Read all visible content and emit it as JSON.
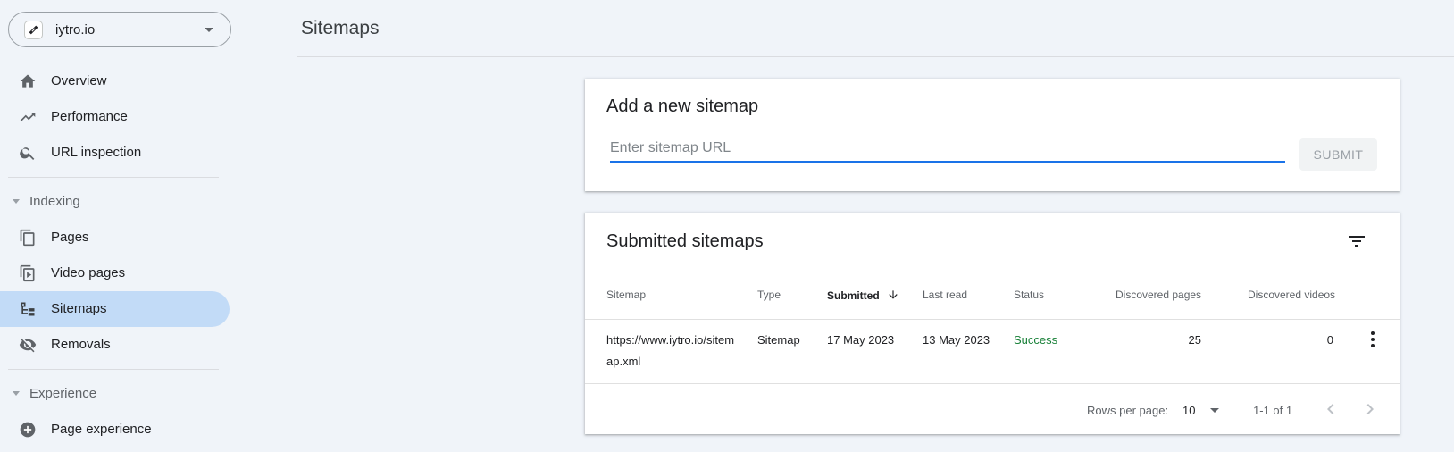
{
  "property": {
    "name": "iytro.io",
    "icon": "link-icon"
  },
  "nav": {
    "overview": {
      "label": "Overview",
      "icon": "home-icon"
    },
    "performance": {
      "label": "Performance",
      "icon": "trending-up-icon"
    },
    "url_inspection": {
      "label": "URL inspection",
      "icon": "search-icon"
    },
    "indexing_section": "Indexing",
    "pages": {
      "label": "Pages",
      "icon": "pages-icon"
    },
    "video_pages": {
      "label": "Video pages",
      "icon": "video-pages-icon"
    },
    "sitemaps": {
      "label": "Sitemaps",
      "icon": "sitemap-icon"
    },
    "removals": {
      "label": "Removals",
      "icon": "visibility-off-icon"
    },
    "experience_section": "Experience",
    "page_experience": {
      "label": "Page experience",
      "icon": "add-circle-icon"
    }
  },
  "header": {
    "title": "Sitemaps"
  },
  "add_card": {
    "title": "Add a new sitemap",
    "input_placeholder": "Enter sitemap URL",
    "input_value": "",
    "submit_label": "SUBMIT"
  },
  "submitted_card": {
    "title": "Submitted sitemaps",
    "columns": {
      "sitemap": "Sitemap",
      "type": "Type",
      "submitted": "Submitted",
      "last_read": "Last read",
      "status": "Status",
      "discovered_pages": "Discovered pages",
      "discovered_videos": "Discovered videos"
    },
    "rows": [
      {
        "sitemap": "https://www.iytro.io/sitemap.xml",
        "type": "Sitemap",
        "submitted": "17 May 2023",
        "last_read": "13 May 2023",
        "status": "Success",
        "discovered_pages": "25",
        "discovered_videos": "0"
      }
    ],
    "footer": {
      "rows_per_page_label": "Rows per page:",
      "rows_per_page_value": "10",
      "range": "1-1 of 1"
    }
  },
  "colors": {
    "accent": "#1a73e8",
    "active_nav": "#c2dbf7",
    "success": "#188038",
    "background": "#f0f4f9"
  }
}
